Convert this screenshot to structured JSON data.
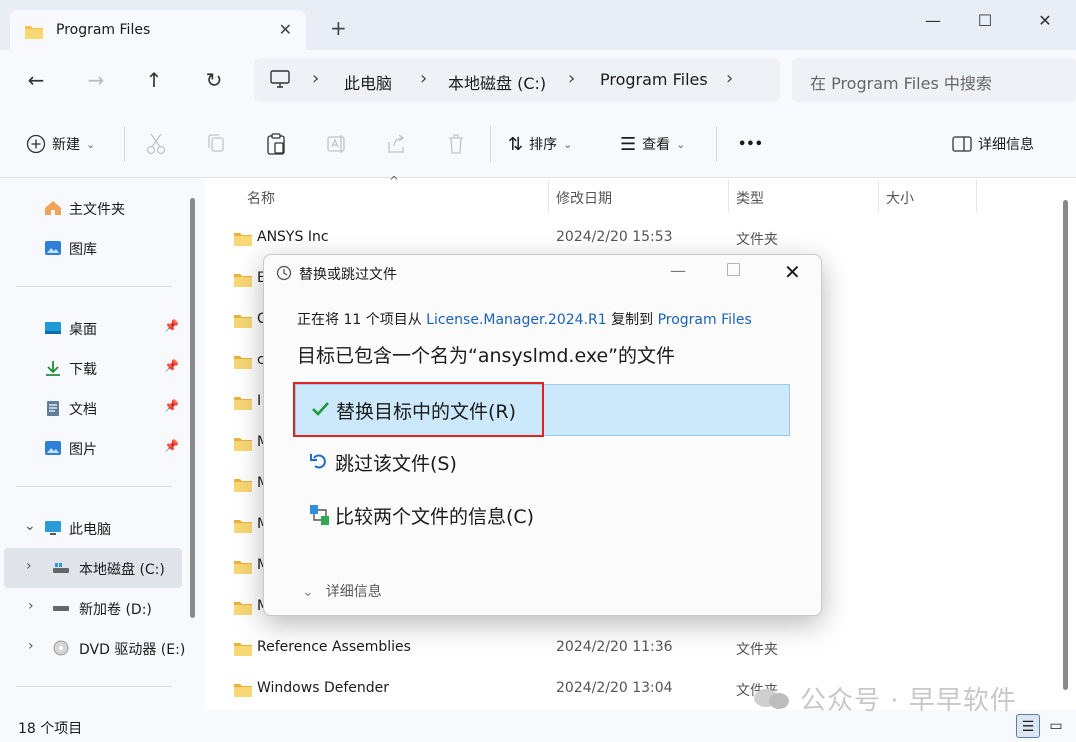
{
  "window": {
    "tab_title": "Program Files",
    "tab_close": "✕",
    "new_tab": "+",
    "minimize": "—",
    "maximize": "☐",
    "close": "✕"
  },
  "nav": {
    "back": "←",
    "forward": "→",
    "up": "↑",
    "refresh": "↻",
    "breadcrumbs": [
      "此电脑",
      "本地磁盘 (C:)",
      "Program Files"
    ],
    "separator": "›",
    "search_placeholder": "在 Program Files 中搜索"
  },
  "toolbar": {
    "new_label": "新建",
    "sort_label": "排序",
    "view_label": "查看",
    "more": "•••",
    "details_label": "详细信息",
    "dropdown": "⌄"
  },
  "sidebar": {
    "quick": [
      {
        "label": "主文件夹",
        "icon": "home-icon"
      },
      {
        "label": "图库",
        "icon": "gallery-icon"
      }
    ],
    "pinned": [
      {
        "label": "桌面",
        "icon": "desktop-icon"
      },
      {
        "label": "下载",
        "icon": "download-icon"
      },
      {
        "label": "文档",
        "icon": "document-icon"
      },
      {
        "label": "图片",
        "icon": "picture-icon"
      }
    ],
    "pc": {
      "label": "此电脑"
    },
    "drives": [
      {
        "label": "本地磁盘 (C:)",
        "selected": true
      },
      {
        "label": "新加卷 (D:)",
        "selected": false
      },
      {
        "label": "DVD 驱动器 (E:)",
        "selected": false
      }
    ]
  },
  "filelist": {
    "columns": [
      "名称",
      "修改日期",
      "类型",
      "大小"
    ],
    "rows": [
      {
        "name": "ANSYS Inc",
        "date": "2024/2/20 15:53",
        "type": "文件夹"
      },
      {
        "name": "E",
        "date": "",
        "type": ""
      },
      {
        "name": "C",
        "date": "",
        "type": ""
      },
      {
        "name": "c",
        "date": "",
        "type": ""
      },
      {
        "name": "I",
        "date": "",
        "type": ""
      },
      {
        "name": "M",
        "date": "",
        "type": ""
      },
      {
        "name": "M",
        "date": "",
        "type": ""
      },
      {
        "name": "M",
        "date": "",
        "type": ""
      },
      {
        "name": "M",
        "date": "",
        "type": ""
      },
      {
        "name": "M",
        "date": "",
        "type": ""
      },
      {
        "name": "Reference Assemblies",
        "date": "2024/2/20 11:36",
        "type": "文件夹"
      },
      {
        "name": "Windows Defender",
        "date": "2024/2/20 13:04",
        "type": "文件夹"
      }
    ]
  },
  "status": {
    "count": "18 个项目",
    "watermark": "公众号 · 早早软件"
  },
  "dialog": {
    "title": "替换或跳过文件",
    "info_prefix": "正在将 11 个项目从 ",
    "source": "License.Manager.2024.R1",
    "info_mid": " 复制到 ",
    "destination": "Program Files",
    "heading": "目标已包含一个名为“ansyslmd.exe”的文件",
    "options": [
      {
        "label": "替换目标中的文件(R)",
        "icon": "checkmark-icon"
      },
      {
        "label": "跳过该文件(S)",
        "icon": "undo-icon"
      },
      {
        "label": "比较两个文件的信息(C)",
        "icon": "compare-icon"
      }
    ],
    "details": "详细信息",
    "close": "✕",
    "colors": {
      "highlight": "#cce8fb",
      "annotation": "#e0231e",
      "link": "#1c63b7"
    }
  }
}
